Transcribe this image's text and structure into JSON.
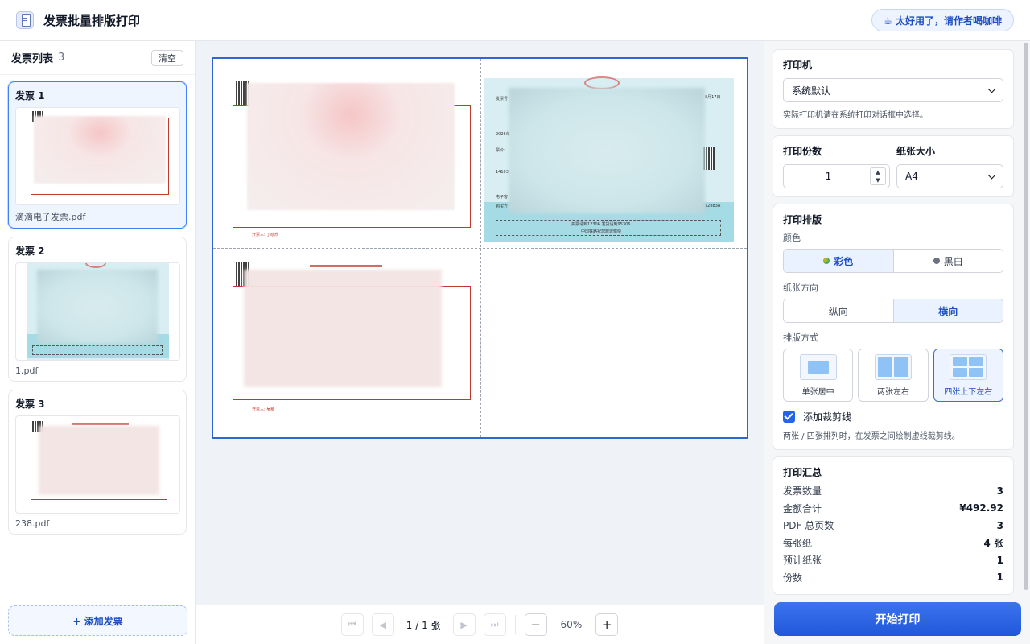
{
  "header": {
    "title": "发票批量排版打印",
    "coffee_label": "☕ 太好用了，请作者喝咖啡"
  },
  "sidebar": {
    "title": "发票列表",
    "count": "3",
    "clear_label": "清空",
    "invoices": [
      {
        "title": "发票 1",
        "filename": "滴滴电子发票.pdf",
        "selected": true
      },
      {
        "title": "发票 2",
        "filename": "1.pdf",
        "selected": false
      },
      {
        "title": "发票 3",
        "filename": "238.pdf",
        "selected": false
      }
    ],
    "add_label": "+ 添加发票"
  },
  "preview": {
    "train_ticket": {
      "date": "8月17日",
      "line1": "发票号",
      "line2": "2026年",
      "line3": "票价:",
      "line4": "14103",
      "line5": "电子客",
      "line6": "购买方",
      "code": "12883A",
      "footer1": "买票请到12306 发货请到95306",
      "footer2": "中国铁路祝您旅途愉快"
    },
    "invoice_a_note": "开票人: 丁晓欣",
    "invoice_c_note": "开票人: 吴敏"
  },
  "toolbar": {
    "first_icon": "⏮",
    "prev_icon": "◀",
    "page_indicator": "1 / 1 张",
    "next_icon": "▶",
    "last_icon": "⏭",
    "zoom_out": "−",
    "zoom_level": "60%",
    "zoom_in": "+"
  },
  "settings": {
    "printer": {
      "title": "打印机",
      "value": "系统默认",
      "hint": "实际打印机请在系统打印对话框中选择。"
    },
    "copies": {
      "title": "打印份数",
      "value": "1"
    },
    "paper": {
      "title": "纸张大小",
      "value": "A4"
    },
    "layout": {
      "title": "打印排版",
      "color_label": "颜色",
      "color_options": [
        "彩色",
        "黑白"
      ],
      "color_active": 0,
      "orientation_label": "纸张方向",
      "orientation_options": [
        "纵向",
        "横向"
      ],
      "orientation_active": 1,
      "mode_label": "排版方式",
      "mode_options": [
        "单张居中",
        "两张左右",
        "四张上下左右"
      ],
      "mode_active": 2,
      "cutline_label": "添加裁剪线",
      "cutline_checked": true,
      "cutline_hint": "两张 / 四张排列时，在发票之间绘制虚线裁剪线。"
    },
    "summary": {
      "title": "打印汇总",
      "rows": [
        {
          "label": "发票数量",
          "value": "3"
        },
        {
          "label": "金额合计",
          "value": "¥492.92"
        },
        {
          "label": "PDF 总页数",
          "value": "3"
        },
        {
          "label": "每张纸",
          "value": "4 张"
        },
        {
          "label": "预计纸张",
          "value": "1"
        },
        {
          "label": "份数",
          "value": "1"
        }
      ]
    },
    "print_label": "开始打印"
  },
  "colors": {
    "accent": "#2563eb",
    "color_dot": "#4caf50",
    "bw_dot": "#6b7280"
  }
}
